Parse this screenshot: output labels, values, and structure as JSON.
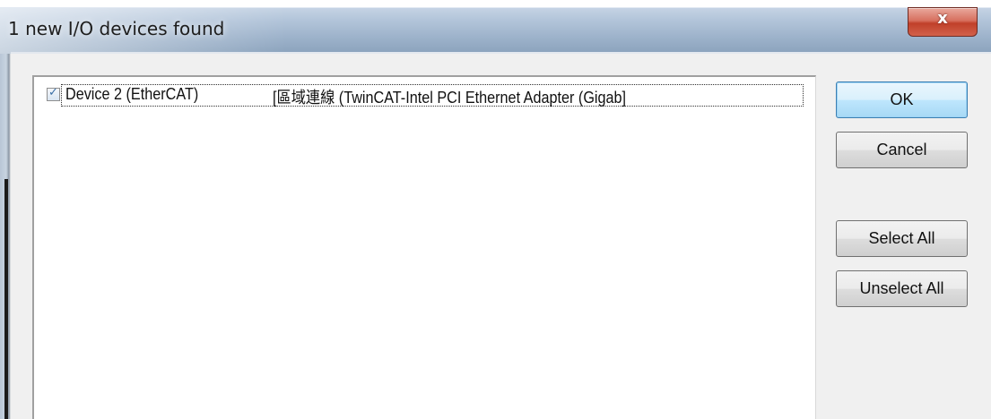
{
  "window": {
    "title": "1 new I/O devices found",
    "close_glyph": "x"
  },
  "device_list": {
    "items": [
      {
        "checked": true,
        "check_glyph": "✓",
        "name": "Device 2 (EtherCAT)",
        "adapter": "[區域連線 (TwinCAT-Intel PCI Ethernet Adapter (Gigab]"
      }
    ]
  },
  "buttons": {
    "ok": "OK",
    "cancel": "Cancel",
    "select_all": "Select All",
    "unselect_all": "Unselect All"
  },
  "colors": {
    "close_button": "#c7462f",
    "default_button_border": "#3c7fb1",
    "check_mark": "#3a6ea5"
  }
}
